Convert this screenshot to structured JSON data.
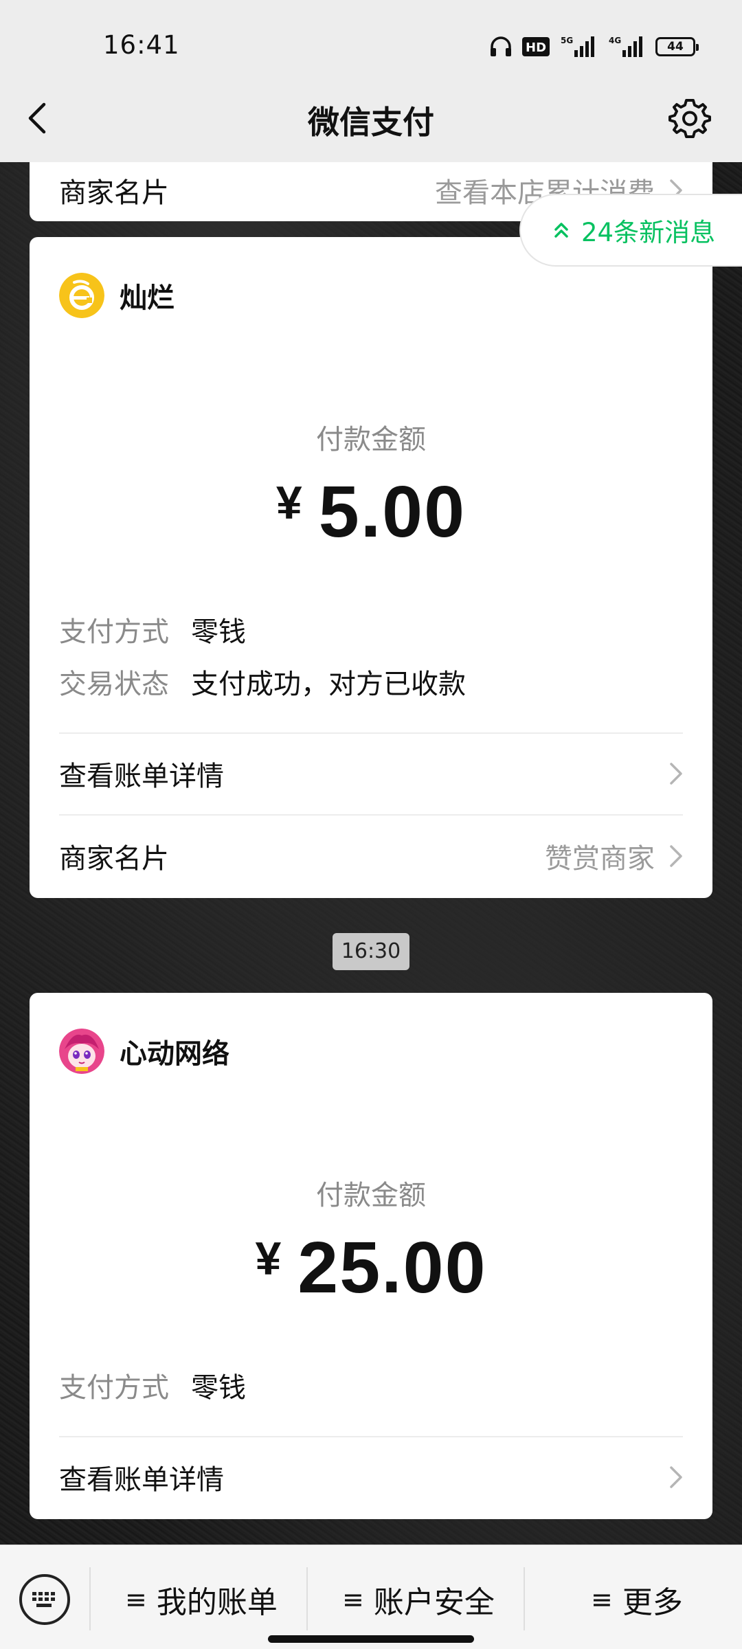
{
  "status_bar": {
    "time": "16:41",
    "battery": "44",
    "icons": [
      "headphones-icon",
      "hd-icon",
      "5g-signal-icon",
      "4g-signal-icon",
      "battery-icon"
    ]
  },
  "nav": {
    "title": "微信支付",
    "back_icon": "chevron-left-icon",
    "settings_icon": "gear-icon"
  },
  "partial_card": {
    "label": "商家名片",
    "value": "查看本店累计消费"
  },
  "new_messages": {
    "text": "24条新消息",
    "icon": "double-chevron-up-icon"
  },
  "payments": [
    {
      "merchant": "灿烂",
      "amount_label": "付款金额",
      "currency": "¥",
      "amount": "5.00",
      "details": [
        {
          "key": "支付方式",
          "value": "零钱"
        },
        {
          "key": "交易状态",
          "value": "支付成功，对方已收款"
        }
      ],
      "bill_link": "查看账单详情",
      "card_label": "商家名片",
      "card_value": "赞赏商家"
    },
    {
      "merchant": "心动网络",
      "amount_label": "付款金额",
      "currency": "¥",
      "amount": "25.00",
      "details": [
        {
          "key": "支付方式",
          "value": "零钱"
        }
      ],
      "bill_link": "查看账单详情"
    }
  ],
  "timestamp": "16:30",
  "bottom_menu": {
    "keyboard_icon": "keyboard-icon",
    "items": [
      {
        "label": "我的账单"
      },
      {
        "label": "账户安全"
      },
      {
        "label": "更多"
      }
    ]
  },
  "colors": {
    "accent": "#07c160",
    "merchant1_avatar": "#f7c31a",
    "merchant2_avatar": "#e8458b"
  }
}
